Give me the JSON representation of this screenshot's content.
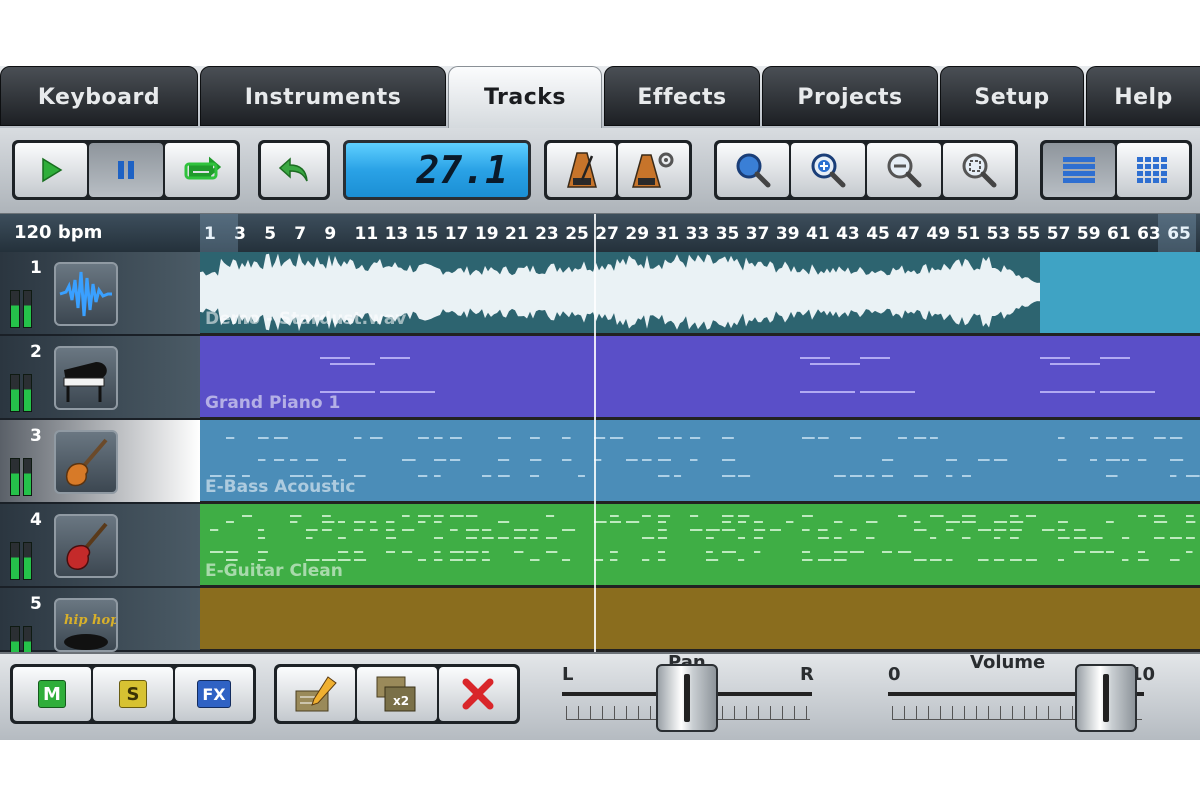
{
  "tabs": [
    {
      "label": "Keyboard",
      "active": false
    },
    {
      "label": "Instruments",
      "active": false
    },
    {
      "label": "Tracks",
      "active": true
    },
    {
      "label": "Effects",
      "active": false
    },
    {
      "label": "Projects",
      "active": false
    },
    {
      "label": "Setup",
      "active": false
    },
    {
      "label": "Help",
      "active": false
    }
  ],
  "toolbar": {
    "transport": [
      "play-icon",
      "pause-icon",
      "loop-icon"
    ],
    "undo": "undo-icon",
    "position_display": "27.1",
    "metronome": [
      "metronome-icon",
      "metronome-settings-icon"
    ],
    "zoom": [
      "search-icon",
      "zoom-in-icon",
      "zoom-out-icon",
      "zoom-fit-icon"
    ],
    "view": [
      "list-view-icon",
      "grid-view-icon"
    ]
  },
  "ruler": {
    "tempo": "120 bpm",
    "marks": [
      "1",
      "3",
      "5",
      "7",
      "9",
      "11",
      "13",
      "15",
      "17",
      "19",
      "21",
      "23",
      "25",
      "27",
      "29",
      "31",
      "33",
      "35",
      "37",
      "39",
      "41",
      "43",
      "45",
      "47",
      "49",
      "51",
      "53",
      "55",
      "57",
      "59",
      "61",
      "63",
      "65"
    ]
  },
  "tracks": [
    {
      "number": "1",
      "name": "Demo - Stardust.wav",
      "icon": "waveform-icon",
      "color": "#2d6d80"
    },
    {
      "number": "2",
      "name": "Grand Piano 1",
      "icon": "grand-piano-icon",
      "color": "#5a4fc8"
    },
    {
      "number": "3",
      "name": "E-Bass Acoustic",
      "icon": "bass-guitar-icon",
      "color": "#4b8db8"
    },
    {
      "number": "4",
      "name": "E-Guitar Clean",
      "icon": "electric-guitar-icon",
      "color": "#3fae45"
    },
    {
      "number": "5",
      "name": "",
      "icon": "hip-hop-drums-icon",
      "color": "#8a6d1e"
    }
  ],
  "bottom": {
    "mute": "M",
    "solo": "S",
    "fx": "FX",
    "tools": [
      "edit-pencil-icon",
      "duplicate-x2-icon",
      "delete-x-icon"
    ],
    "duplicate_badge": "x2",
    "pan": {
      "label": "Pan",
      "left": "L",
      "right": "R",
      "value": 0.5
    },
    "volume": {
      "label": "Volume",
      "min": "0",
      "max": "10",
      "value": 0.85
    }
  },
  "colors": {
    "lcd": "#3bb6f2",
    "meter": "#25c24a",
    "accent_blue": "#1f76c8"
  }
}
